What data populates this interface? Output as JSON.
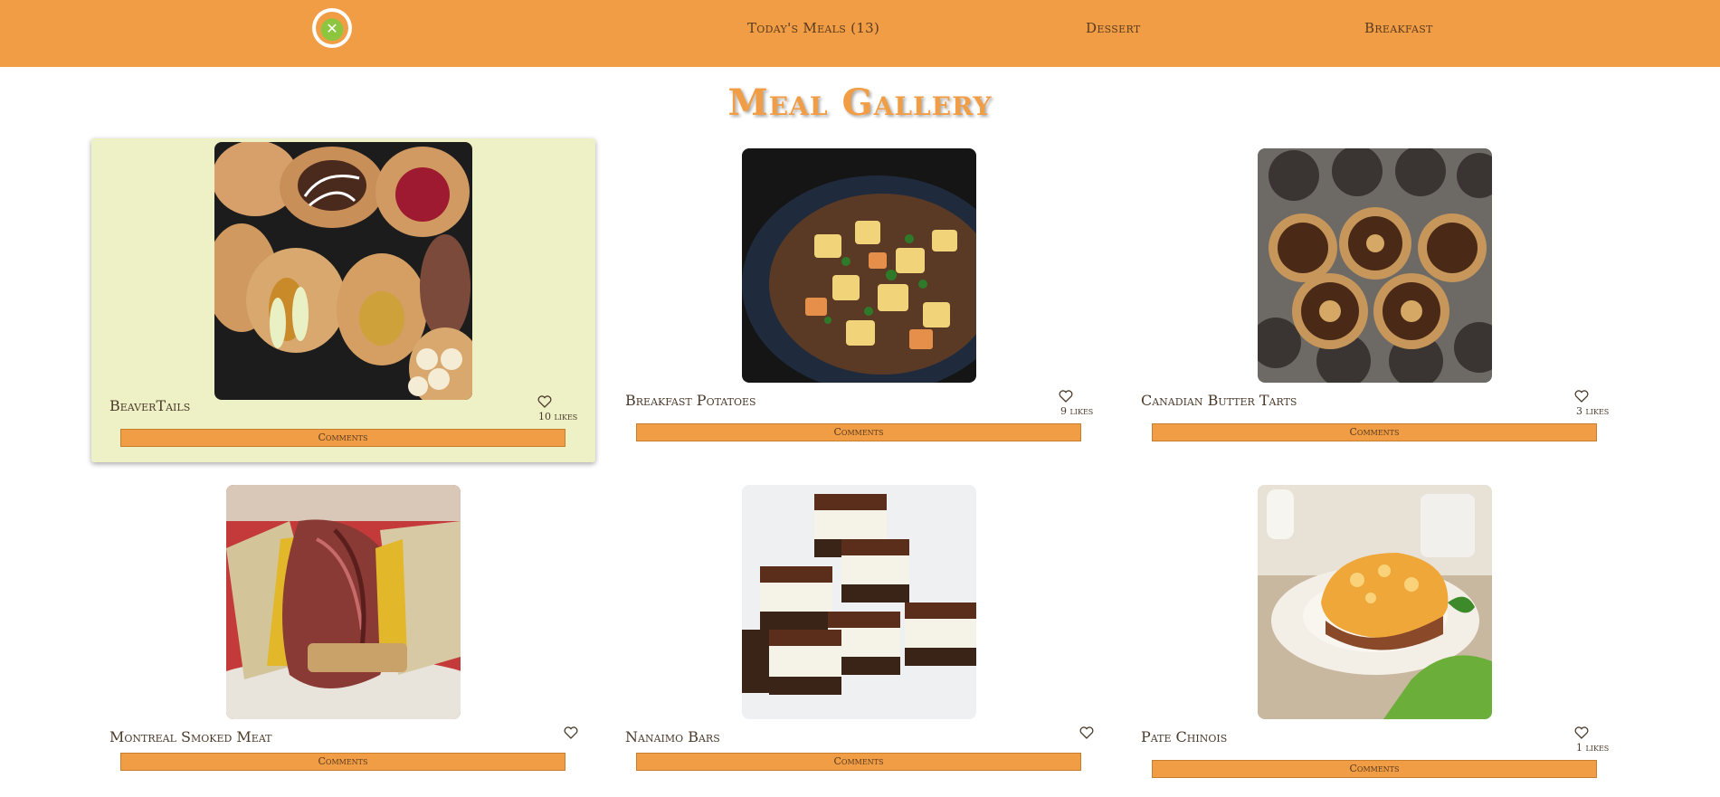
{
  "nav": {
    "logo_icon": "fork-knife-logo-icon",
    "todays_meals": "Today's Meals (13)",
    "dessert": "Dessert",
    "breakfast": "Breakfast"
  },
  "page": {
    "title": "Meal Gallery"
  },
  "colors": {
    "primary": "#f09d45",
    "highlight": "#eef0c6",
    "text": "#4a3a2a"
  },
  "meals": [
    {
      "name": "BeaverTails",
      "likes": "10 likes",
      "comments_label": "Comments",
      "photo": "beavertails-photo"
    },
    {
      "name": "Breakfast Potatoes",
      "likes": "9 likes",
      "comments_label": "Comments",
      "photo": "breakfast-potatoes-photo"
    },
    {
      "name": "Canadian Butter Tarts",
      "likes": "3 likes",
      "comments_label": "Comments",
      "photo": "butter-tarts-photo"
    },
    {
      "name": "Montreal Smoked Meat",
      "likes": "",
      "comments_label": "Comments",
      "photo": "smoked-meat-photo"
    },
    {
      "name": "Nanaimo Bars",
      "likes": "",
      "comments_label": "Comments",
      "photo": "nanaimo-bars-photo"
    },
    {
      "name": "Pate Chinois",
      "likes": "1 likes",
      "comments_label": "Comments",
      "photo": "pate-chinois-photo"
    }
  ]
}
